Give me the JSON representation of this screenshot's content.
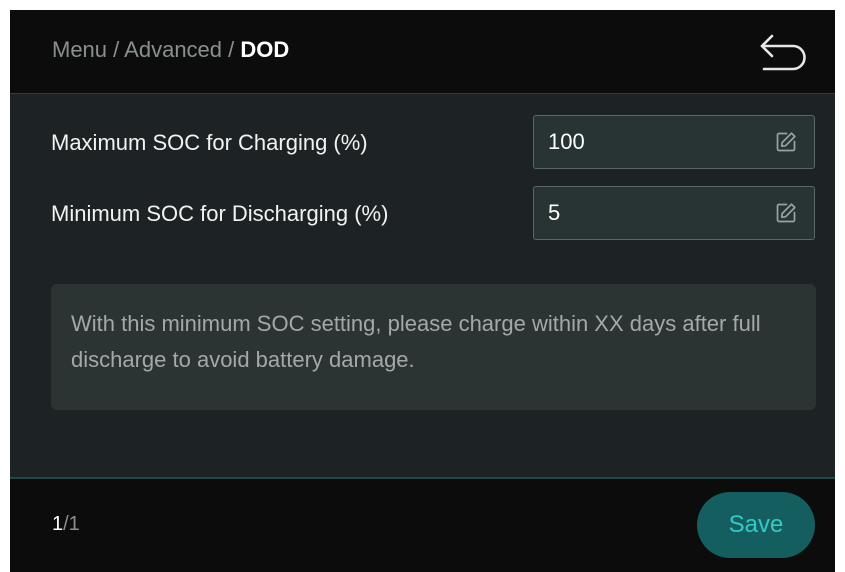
{
  "header": {
    "breadcrumb_menu": "Menu",
    "breadcrumb_separator": " / ",
    "breadcrumb_advanced": "Advanced",
    "breadcrumb_current": "DOD",
    "back_icon": "back-arrow-icon"
  },
  "settings": {
    "max_soc": {
      "label": "Maximum SOC for Charging (%)",
      "value": "100",
      "icon": "edit-icon"
    },
    "min_soc": {
      "label": "Minimum SOC for Discharging (%)",
      "value": "5",
      "icon": "edit-icon"
    }
  },
  "notice": {
    "text": "With this minimum SOC setting, please charge within XX days after full discharge to avoid battery damage."
  },
  "footer": {
    "page_current": "1",
    "page_total": "/1",
    "save_label": "Save"
  },
  "colors": {
    "accent": "#33c9c6",
    "save_button_bg": "#155e5f",
    "header_bg": "#0c0c0c",
    "content_bg": "#1d2324"
  }
}
